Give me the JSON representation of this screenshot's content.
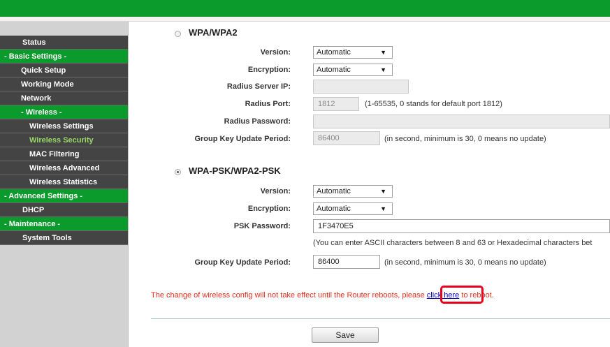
{
  "sidebar": {
    "items": [
      {
        "label": "Status"
      },
      {
        "label": "- Basic Settings -"
      },
      {
        "label": "Quick Setup"
      },
      {
        "label": "Working Mode"
      },
      {
        "label": "Network"
      },
      {
        "label": "- Wireless -"
      },
      {
        "label": "Wireless Settings"
      },
      {
        "label": "Wireless Security"
      },
      {
        "label": "MAC Filtering"
      },
      {
        "label": "Wireless Advanced"
      },
      {
        "label": "Wireless Statistics"
      },
      {
        "label": "- Advanced Settings -"
      },
      {
        "label": "DHCP"
      },
      {
        "label": "- Maintenance -"
      },
      {
        "label": "System Tools"
      }
    ]
  },
  "wpa": {
    "title": "WPA/WPA2",
    "selected": false,
    "version_label": "Version:",
    "version_value": "Automatic",
    "encryption_label": "Encryption:",
    "encryption_value": "Automatic",
    "radius_ip_label": "Radius Server IP:",
    "radius_ip_value": "",
    "radius_port_label": "Radius Port:",
    "radius_port_value": "1812",
    "radius_port_hint": "(1-65535, 0 stands for default port 1812)",
    "radius_password_label": "Radius Password:",
    "radius_password_value": "",
    "group_key_label": "Group Key Update Period:",
    "group_key_value": "86400",
    "group_key_hint": "(in second, minimum is 30, 0 means no update)"
  },
  "psk": {
    "title": "WPA-PSK/WPA2-PSK",
    "selected": true,
    "version_label": "Version:",
    "version_value": "Automatic",
    "encryption_label": "Encryption:",
    "encryption_value": "Automatic",
    "password_label": "PSK Password:",
    "password_value": "1F3470E5",
    "password_hint": "(You can enter ASCII characters between 8 and 63 or Hexadecimal characters bet",
    "group_key_label": "Group Key Update Period:",
    "group_key_value": "86400",
    "group_key_hint": "(in second, minimum is 30, 0 means no update)"
  },
  "notice": {
    "before": "The change of wireless config will not take effect until the Router reboots, please ",
    "link": "click here",
    "after": " to reboot."
  },
  "save_label": "Save",
  "colors": {
    "accent_green": "#0b9a2c",
    "sidebar_dark": "#444444",
    "warning_red": "#e0301e",
    "highlight_red": "#e8001c"
  }
}
